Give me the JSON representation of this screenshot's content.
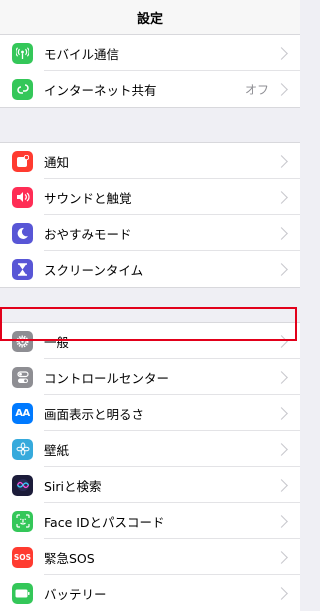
{
  "nav": {
    "title": "設定"
  },
  "group1": [
    {
      "id": "mobile",
      "label": "モバイル通信",
      "icon": "antenna-icon",
      "color": "#34c759"
    },
    {
      "id": "hotspot",
      "label": "インターネット共有",
      "icon": "link-icon",
      "color": "#34c759",
      "value": "オフ"
    }
  ],
  "group2": [
    {
      "id": "notifications",
      "label": "通知",
      "icon": "notification-icon",
      "color": "#ff3b30"
    },
    {
      "id": "sounds",
      "label": "サウンドと触覚",
      "icon": "speaker-icon",
      "color": "#ff2d55"
    },
    {
      "id": "dnd",
      "label": "おやすみモード",
      "icon": "moon-icon",
      "color": "#5856d6"
    },
    {
      "id": "screentime",
      "label": "スクリーンタイム",
      "icon": "hourglass-icon",
      "color": "#5856d6"
    }
  ],
  "group3": [
    {
      "id": "general",
      "label": "一般",
      "icon": "gear-icon",
      "color": "#8e8e93"
    },
    {
      "id": "control",
      "label": "コントロールセンター",
      "icon": "toggles-icon",
      "color": "#8e8e93"
    },
    {
      "id": "display",
      "label": "画面表示と明るさ",
      "icon": "text-size-icon",
      "color": "#007aff",
      "icon_text": "AA"
    },
    {
      "id": "wallpaper",
      "label": "壁紙",
      "icon": "flower-icon",
      "color": "#36aadc"
    },
    {
      "id": "siri",
      "label": "Siriと検索",
      "icon": "siri-icon",
      "color": "#1c1c3a"
    },
    {
      "id": "faceid",
      "label": "Face IDとパスコード",
      "icon": "faceid-icon",
      "color": "#34c759"
    },
    {
      "id": "sos",
      "label": "緊急SOS",
      "icon": "sos-icon",
      "color": "#ff3b30",
      "icon_text": "SOS"
    },
    {
      "id": "battery",
      "label": "バッテリー",
      "icon": "battery-icon",
      "color": "#34c759"
    }
  ]
}
